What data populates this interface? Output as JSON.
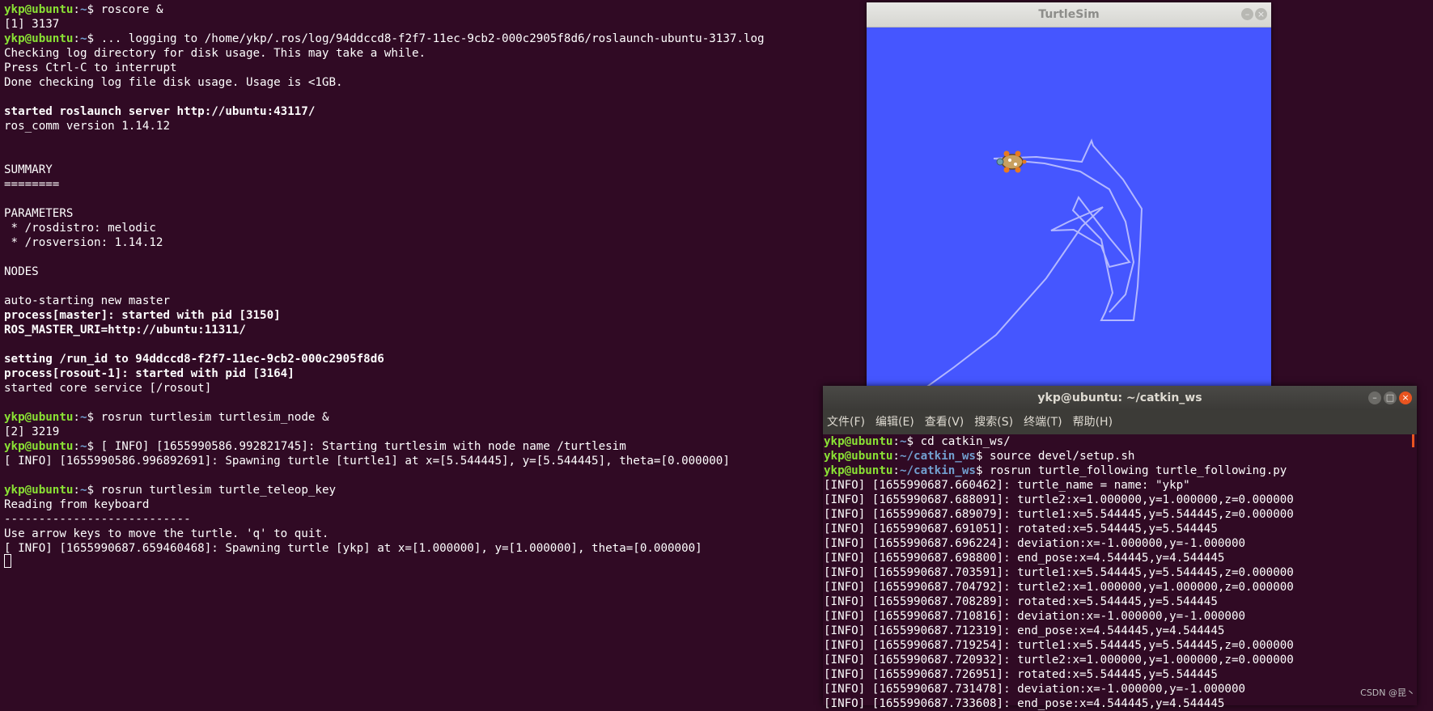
{
  "main_terminal": {
    "lines": [
      {
        "user": "ykp@ubuntu",
        "path": "~",
        "sym": "$ ",
        "text": "roscore &"
      },
      {
        "text": "[1] 3137"
      },
      {
        "user": "ykp@ubuntu",
        "path": "~",
        "sym": "$ ",
        "text": "... logging to /home/ykp/.ros/log/94ddccd8-f2f7-11ec-9cb2-000c2905f8d6/roslaunch-ubuntu-3137.log"
      },
      {
        "text": "Checking log directory for disk usage. This may take a while."
      },
      {
        "text": "Press Ctrl-C to interrupt"
      },
      {
        "text": "Done checking log file disk usage. Usage is <1GB."
      },
      {
        "text": ""
      },
      {
        "text": "started roslaunch server http://ubuntu:43117/",
        "bold": true
      },
      {
        "text": "ros_comm version 1.14.12"
      },
      {
        "text": ""
      },
      {
        "text": ""
      },
      {
        "text": "SUMMARY"
      },
      {
        "text": "========"
      },
      {
        "text": ""
      },
      {
        "text": "PARAMETERS"
      },
      {
        "text": " * /rosdistro: melodic"
      },
      {
        "text": " * /rosversion: 1.14.12"
      },
      {
        "text": ""
      },
      {
        "text": "NODES"
      },
      {
        "text": ""
      },
      {
        "text": "auto-starting new master"
      },
      {
        "text": "process[master]: started with pid [3150]",
        "bold": true
      },
      {
        "text": "ROS_MASTER_URI=http://ubuntu:11311/",
        "bold": true
      },
      {
        "text": ""
      },
      {
        "text": "setting /run_id to 94ddccd8-f2f7-11ec-9cb2-000c2905f8d6",
        "bold": true
      },
      {
        "text": "process[rosout-1]: started with pid [3164]",
        "bold": true
      },
      {
        "text": "started core service [/rosout]"
      },
      {
        "text": ""
      },
      {
        "user": "ykp@ubuntu",
        "path": "~",
        "sym": "$ ",
        "text": "rosrun turtlesim turtlesim_node &"
      },
      {
        "text": "[2] 3219"
      },
      {
        "user": "ykp@ubuntu",
        "path": "~",
        "sym": "$ ",
        "text": "[ INFO] [1655990586.992821745]: Starting turtlesim with node name /turtlesim"
      },
      {
        "text": "[ INFO] [1655990586.996892691]: Spawning turtle [turtle1] at x=[5.544445], y=[5.544445], theta=[0.000000]"
      },
      {
        "text": ""
      },
      {
        "user": "ykp@ubuntu",
        "path": "~",
        "sym": "$ ",
        "text": "rosrun turtlesim turtle_teleop_key"
      },
      {
        "text": "Reading from keyboard"
      },
      {
        "text": "---------------------------"
      },
      {
        "text": "Use arrow keys to move the turtle. 'q' to quit."
      },
      {
        "text": "[ INFO] [1655990687.659460468]: Spawning turtle [ykp] at x=[1.000000], y=[1.000000], theta=[0.000000]"
      }
    ]
  },
  "turtlesim": {
    "title": "TurtleSim",
    "bg_color": "#4556ff",
    "path_color": "#b3b8ff"
  },
  "terminal2": {
    "title": "ykp@ubuntu: ~/catkin_ws",
    "menu": [
      "文件(F)",
      "编辑(E)",
      "查看(V)",
      "搜索(S)",
      "终端(T)",
      "帮助(H)"
    ],
    "lines": [
      {
        "user": "ykp@ubuntu",
        "path": "~",
        "sym": "$ ",
        "text": "cd catkin_ws/"
      },
      {
        "user": "ykp@ubuntu",
        "path": "~/catkin_ws",
        "sym": "$ ",
        "text": "source devel/setup.sh"
      },
      {
        "user": "ykp@ubuntu",
        "path": "~/catkin_ws",
        "sym": "$ ",
        "text": "rosrun turtle_following turtle_following.py"
      },
      {
        "text": "[INFO] [1655990687.660462]: turtle_name = name: \"ykp\""
      },
      {
        "text": "[INFO] [1655990687.688091]: turtle2:x=1.000000,y=1.000000,z=0.000000"
      },
      {
        "text": "[INFO] [1655990687.689079]: turtle1:x=5.544445,y=5.544445,z=0.000000"
      },
      {
        "text": "[INFO] [1655990687.691051]: rotated:x=5.544445,y=5.544445"
      },
      {
        "text": "[INFO] [1655990687.696224]: deviation:x=-1.000000,y=-1.000000"
      },
      {
        "text": "[INFO] [1655990687.698800]: end_pose:x=4.544445,y=4.544445"
      },
      {
        "text": "[INFO] [1655990687.703591]: turtle1:x=5.544445,y=5.544445,z=0.000000"
      },
      {
        "text": "[INFO] [1655990687.704792]: turtle2:x=1.000000,y=1.000000,z=0.000000"
      },
      {
        "text": "[INFO] [1655990687.708289]: rotated:x=5.544445,y=5.544445"
      },
      {
        "text": "[INFO] [1655990687.710816]: deviation:x=-1.000000,y=-1.000000"
      },
      {
        "text": "[INFO] [1655990687.712319]: end_pose:x=4.544445,y=4.544445"
      },
      {
        "text": "[INFO] [1655990687.719254]: turtle1:x=5.544445,y=5.544445,z=0.000000"
      },
      {
        "text": "[INFO] [1655990687.720932]: turtle2:x=1.000000,y=1.000000,z=0.000000"
      },
      {
        "text": "[INFO] [1655990687.726951]: rotated:x=5.544445,y=5.544445"
      },
      {
        "text": "[INFO] [1655990687.731478]: deviation:x=-1.000000,y=-1.000000"
      },
      {
        "text": "[INFO] [1655990687.733608]: end_pose:x=4.544445,y=4.544445"
      }
    ]
  },
  "watermark": "CSDN @昆丶"
}
